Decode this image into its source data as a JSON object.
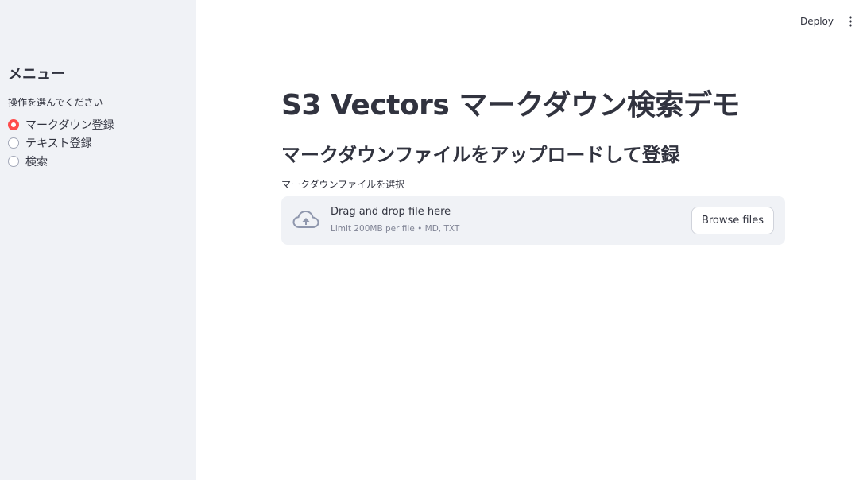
{
  "sidebar": {
    "title": "メニュー",
    "radio_label": "操作を選んでください",
    "options": [
      {
        "label": "マークダウン登録",
        "selected": true
      },
      {
        "label": "テキスト登録",
        "selected": false
      },
      {
        "label": "検索",
        "selected": false
      }
    ]
  },
  "topbar": {
    "deploy_label": "Deploy",
    "menu_icon": "vertical-ellipsis-icon"
  },
  "main": {
    "title": "S3 Vectors マークダウン検索デモ",
    "subtitle": "マークダウンファイルをアップロードして登録",
    "uploader": {
      "label": "マークダウンファイルを選択",
      "drop_text": "Drag and drop file here",
      "hint": "Limit 200MB per file • MD, TXT",
      "browse_label": "Browse files",
      "icon": "cloud-upload-icon"
    }
  },
  "colors": {
    "sidebar_bg": "#f0f2f6",
    "accent": "#ff4b4b",
    "text": "#31333f",
    "muted": "#808495"
  }
}
